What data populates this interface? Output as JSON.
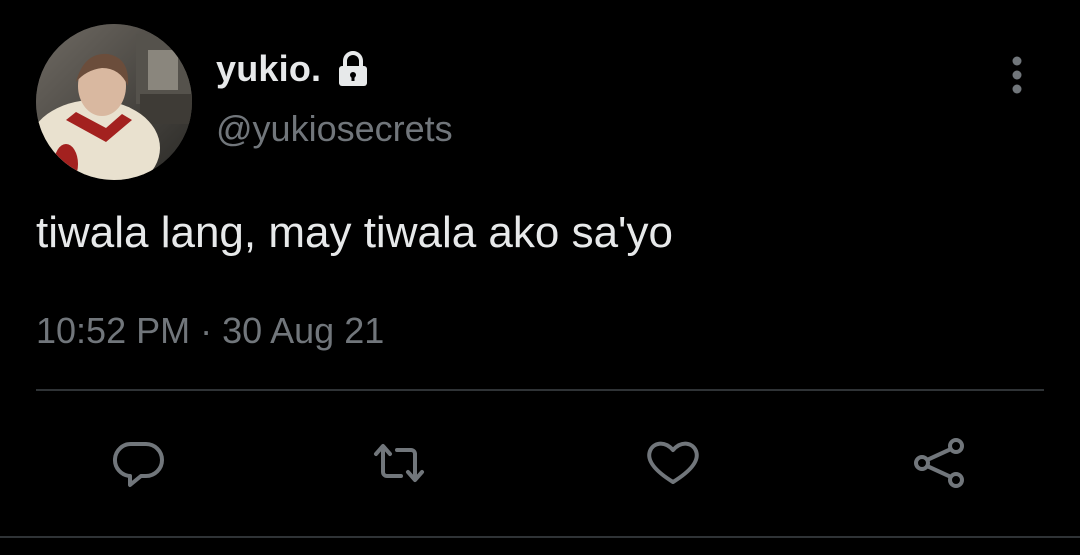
{
  "author": {
    "display_name": "yukio.",
    "handle": "@yukiosecrets",
    "protected_icon": "lock-icon",
    "avatar": "profile-photo"
  },
  "tweet": {
    "text": "tiwala lang, may tiwala ako sa'yo",
    "timestamp": "10:52 PM · 30 Aug 21"
  },
  "actions": [
    {
      "name": "reply",
      "icon": "speech-bubble-icon"
    },
    {
      "name": "retweet",
      "icon": "retweet-arrows-icon"
    },
    {
      "name": "like",
      "icon": "heart-outline-icon"
    },
    {
      "name": "share",
      "icon": "share-nodes-icon"
    }
  ],
  "menu_icon": "vertical-ellipsis-icon",
  "colors": {
    "background": "#000000",
    "primary_text": "#e7e9ea",
    "secondary_text": "#71767b",
    "divider": "#2f3336"
  }
}
